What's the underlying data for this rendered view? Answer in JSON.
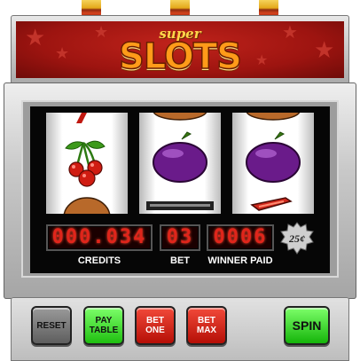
{
  "header": {
    "subtitle": "super",
    "title": "SLOTS"
  },
  "reels": [
    {
      "top": "cherry-partial",
      "center": "cherries",
      "bottom": "fruit-partial"
    },
    {
      "top": "fruit-partial",
      "center": "plum",
      "bottom": "bar-partial"
    },
    {
      "top": "fruit-partial",
      "center": "plum",
      "bottom": "seven-partial"
    }
  ],
  "displays": {
    "credits": {
      "value": "000.034",
      "label": "CREDITS"
    },
    "bet": {
      "value": "03",
      "label": "BET"
    },
    "winner_paid": {
      "value": "0006",
      "label": "WINNER PAID"
    }
  },
  "coin": {
    "label": "25¢"
  },
  "buttons": {
    "reset": "RESET",
    "pay_table": "PAY\nTABLE",
    "bet_one": "BET\nONE",
    "bet_max": "BET\nMAX",
    "spin": "SPIN"
  },
  "colors": {
    "header_red": "#a3150f",
    "display_red": "#e0251b",
    "button_green": "#1fbf10",
    "button_red": "#b50f06",
    "button_gray": "#6e6e6e"
  }
}
